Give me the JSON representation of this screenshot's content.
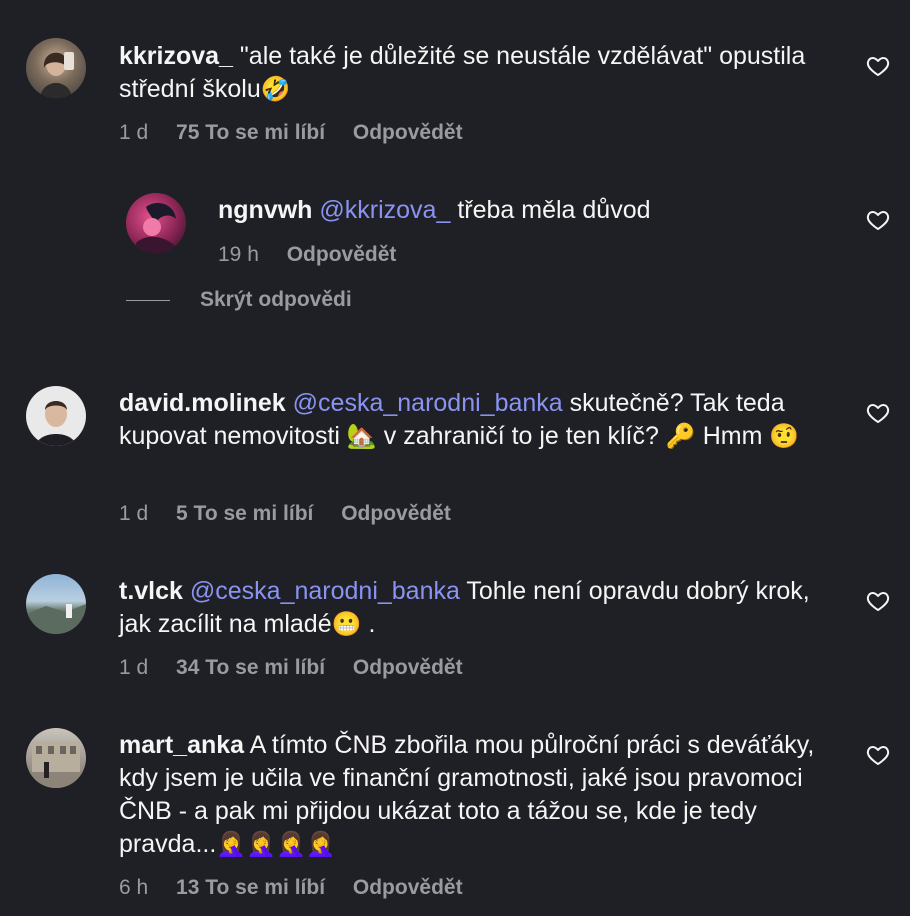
{
  "heart_icon_color": "#f5f5f5",
  "mention_color": "#8a93f2",
  "comments": [
    {
      "username": "kkrizova_",
      "text": "\"ale také je důležité se neustále vzdělávat\" opustila střední školu",
      "emoji": "🤣",
      "time": "1 d",
      "likes": "75 To se mi líbí",
      "reply": "Odpovědět"
    },
    {
      "username": "ngnvwh",
      "mention": "@kkrizova_",
      "text": "třeba měla důvod",
      "time": "19 h",
      "reply": "Odpovědět"
    },
    {
      "username": "david.molinek",
      "mention": "@ceska_narodni_banka",
      "text_part1": "skutečně? Tak teda kupovat nemovitosti",
      "emoji1": "🏡",
      "text_part2": "v zahraničí to je ten klíč?",
      "emoji2": "🔑",
      "text_part3": "Hmm",
      "emoji3": "🤨",
      "time": "1 d",
      "likes": "5 To se mi líbí",
      "reply": "Odpovědět"
    },
    {
      "username": "t.vlck",
      "mention": "@ceska_narodni_banka",
      "text": "Tohle není opravdu dobrý krok, jak zacílit na mladé",
      "emoji": "😬",
      "text_end": ".",
      "time": "1 d",
      "likes": "34 To se mi líbí",
      "reply": "Odpovědět"
    },
    {
      "username": "mart_anka",
      "text": "A tímto ČNB zbořila mou půlroční práci s deváťáky, kdy jsem je učila ve finanční gramotnosti, jaké jsou pravomoci ČNB - a pak mi přijdou ukázat toto a tážou se, kde je tedy pravda...",
      "emoji": "🤦‍♀️🤦‍♀️🤦‍♀️🤦‍♀️",
      "time": "6 h",
      "likes": "13 To se mi líbí",
      "reply": "Odpovědět"
    }
  ],
  "hide_replies": "Skrýt odpovědi"
}
